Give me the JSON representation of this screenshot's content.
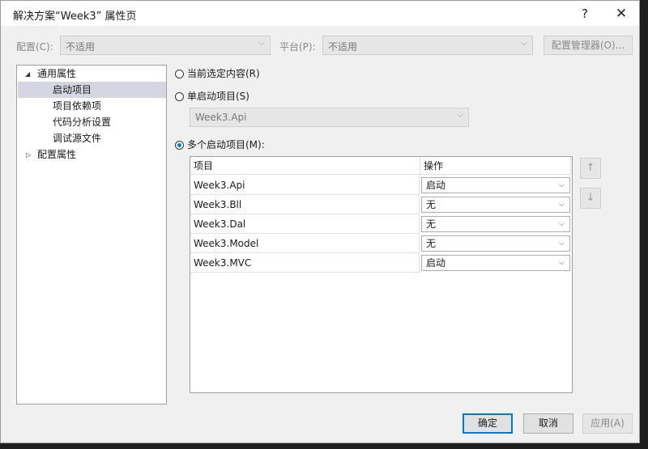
{
  "window": {
    "title": "解决方案“Week3” 属性页",
    "help": "?",
    "close": "✕"
  },
  "config": {
    "config_label": "配置(C):",
    "config_value": "不适用",
    "platform_label": "平台(P):",
    "platform_value": "不适用",
    "manager_button": "配置管理器(O)..."
  },
  "tree": {
    "common": "通用属性",
    "items": [
      "启动项目",
      "项目依赖项",
      "代码分析设置",
      "调试源文件"
    ],
    "config_props": "配置属性"
  },
  "startup": {
    "current_selection": "当前选定内容(R)",
    "single": "单启动项目(S)",
    "single_value": "Week3.Api",
    "multiple": "多个启动项目(M):",
    "selected_option": "multiple"
  },
  "grid": {
    "col_project": "项目",
    "col_action": "操作",
    "rows": [
      {
        "project": "Week3.Api",
        "action": "启动"
      },
      {
        "project": "Week3.Bll",
        "action": "无"
      },
      {
        "project": "Week3.Dal",
        "action": "无"
      },
      {
        "project": "Week3.Model",
        "action": "无"
      },
      {
        "project": "Week3.MVC",
        "action": "启动"
      }
    ]
  },
  "move": {
    "up_icon": "arrow-up-icon",
    "down_icon": "arrow-down-icon"
  },
  "footer": {
    "ok": "确定",
    "cancel": "取消",
    "apply": "应用(A)"
  },
  "colors": {
    "accent": "#0078d7",
    "editor_bg": "#1e1e1e"
  }
}
